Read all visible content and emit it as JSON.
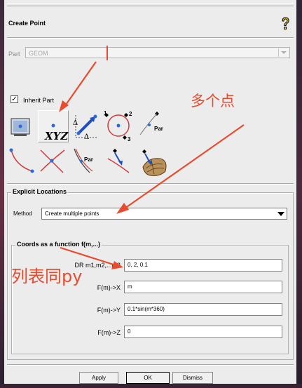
{
  "dialog": {
    "title": "Create Point",
    "help_icon": "help-question-icon",
    "part_label": "Part",
    "part_value": "GEOM",
    "inherit_part_label": "Inherit Part",
    "inherit_part_checked": true
  },
  "toolbar": {
    "row1": [
      {
        "name": "screen-select-point-tool-icon"
      },
      {
        "name": "explicit-xyz-tool-icon",
        "text": "XYZ",
        "selected": true
      },
      {
        "name": "base-point-delta-tool-icon"
      },
      {
        "name": "center-of-arc-tool-icon"
      },
      {
        "name": "curve-parameter-point-tool-icon",
        "text": "Par"
      }
    ],
    "row2": [
      {
        "name": "curve-end-point-tool-icon"
      },
      {
        "name": "curve-curve-intersect-tool-icon"
      },
      {
        "name": "parameter-along-curve-tool-icon",
        "text": "Par"
      },
      {
        "name": "project-point-to-curve-tool-icon"
      },
      {
        "name": "project-point-to-surface-tool-icon"
      }
    ]
  },
  "explicit": {
    "group_title": "Explicit Locations",
    "method_label": "Method",
    "method_value": "Create multiple points",
    "coords_group_title": "Coords as a function f(m,...)",
    "fields": [
      {
        "label": "m1,m2,...m3",
        "prefix": "DR",
        "value": "0, 2, 0.1"
      },
      {
        "label": "F(m)->X",
        "value": "m"
      },
      {
        "label": "F(m)->Y",
        "value": "0.1*sin(m*360)"
      },
      {
        "label": "F(m)->Z",
        "value": "0"
      }
    ]
  },
  "buttons": {
    "apply": "Apply",
    "ok": "OK",
    "dismiss": "Dismiss"
  },
  "annotations": {
    "multiple_points": "多个点",
    "list_like_py": "列表同py",
    "color": "#e74c2f"
  }
}
